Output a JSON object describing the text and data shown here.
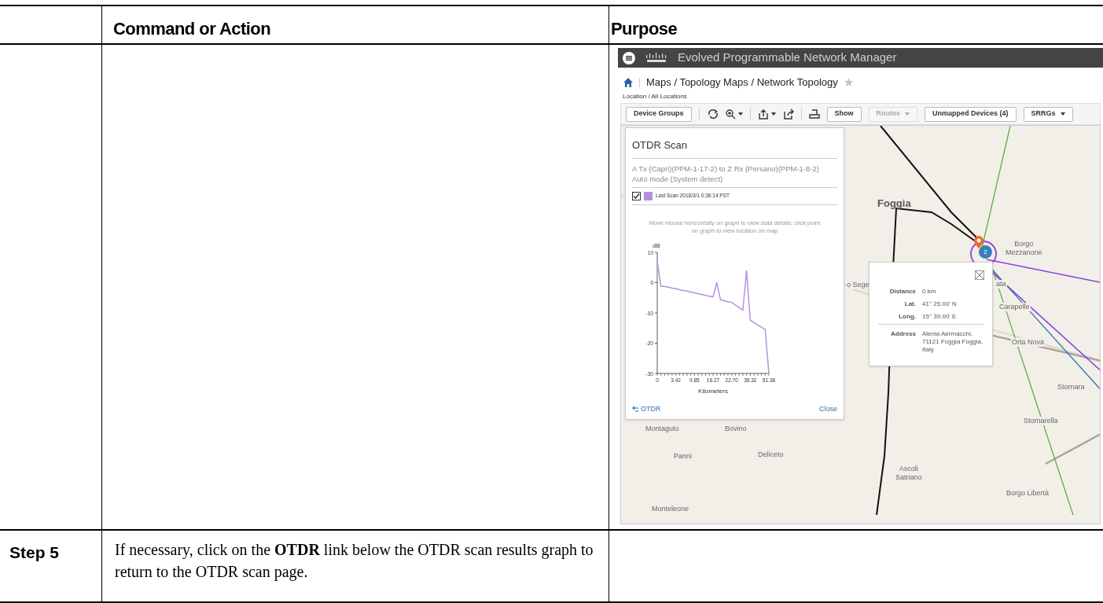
{
  "table": {
    "columns": [
      "Command or Action",
      "Purpose"
    ],
    "rows": [
      {
        "step": null,
        "command": null,
        "screenshot": {
          "app_title": "Evolved Programmable Network Manager",
          "breadcrumb": "Maps / Topology Maps / Network Topology",
          "favorite": false,
          "location": "Location / All Locations",
          "toolbar": [
            {
              "label": "Device Groups",
              "disabled": false,
              "dropdown": false
            },
            {
              "label": "Show",
              "disabled": false,
              "dropdown": false
            },
            {
              "label": "Routes",
              "disabled": true,
              "dropdown": true
            },
            {
              "label": "Unmapped Devices (4)",
              "disabled": false,
              "dropdown": false
            },
            {
              "label": "SRRGs",
              "disabled": false,
              "dropdown": true
            }
          ],
          "otdr_panel": {
            "title": "OTDR Scan",
            "link": "A Tx (Capri)(PPM-1-17-2) to Z Rx (Persano)(PPM-1-8-2)",
            "mode": "Auto mode (System detect)",
            "legend": {
              "checked": true,
              "color": "#b392d9",
              "label": "Last Scan 2018/3/1 0:36:14 PST"
            },
            "hint": "Move mouse horizontally on graph to view data details; click point on graph to view location on map",
            "chart_data": {
              "type": "line",
              "xlabel": "Kilometers",
              "ylabel": "dB",
              "categories": [
                "0",
                null,
                null,
                null,
                null,
                "3.42",
                null,
                null,
                null,
                null,
                "9.85",
                null,
                null,
                null,
                null,
                "16.27",
                null,
                null,
                null,
                null,
                "22.70",
                null,
                null,
                null,
                null,
                "35.32",
                null,
                null,
                null,
                null,
                "51.38"
              ],
              "series": [
                {
                  "color": "#b392d9",
                  "values": [
                    7,
                    -1.2,
                    -1.3,
                    -1.5,
                    -1.8,
                    -2.0,
                    -2.3,
                    -2.6,
                    -2.8,
                    -3.1,
                    -3.4,
                    -3.7,
                    -3.9,
                    -4.2,
                    -4.5,
                    -4.7,
                    0,
                    -5.7,
                    -6.0,
                    -6.3,
                    -6.5,
                    -7.4,
                    -8.2,
                    -9.1,
                    4,
                    -12.4,
                    -13.2,
                    -14.0,
                    -14.7,
                    -15.5,
                    -30
                  ]
                }
              ],
              "ylim": [
                -30,
                10
              ],
              "yticks": [
                10,
                0,
                -10,
                -20,
                -30
              ]
            },
            "back_link": "OTDR",
            "close": "Close"
          },
          "map": {
            "labels": [
              {
                "text": "Foggia",
                "major": true
              },
              {
                "text": "Borgo\nMezzanone",
                "major": false
              },
              {
                "text": "o Sege",
                "major": false
              },
              {
                "text": "ata",
                "major": false
              },
              {
                "text": "Carapelle",
                "major": false
              },
              {
                "text": "Orta Nova",
                "major": false
              },
              {
                "text": "Stornara",
                "major": false
              },
              {
                "text": "Stornarella",
                "major": false
              },
              {
                "text": "Ascoli\nSatriano",
                "major": false
              },
              {
                "text": "Borgo Libertà",
                "major": false
              },
              {
                "text": "Montaguto",
                "major": false
              },
              {
                "text": "Bovino",
                "major": false
              },
              {
                "text": "Panni",
                "major": false
              },
              {
                "text": "Deliceto",
                "major": false
              },
              {
                "text": "Monteleone",
                "major": false
              }
            ],
            "cluster_count": "2",
            "popup": {
              "fields": [
                {
                  "label": "Distance",
                  "value": "0 km"
                },
                {
                  "label": "Lat.",
                  "value": "41° 25.00' N"
                },
                {
                  "label": "Long.",
                  "value": "15° 39.00' E"
                },
                {
                  "label": "Address",
                  "value": "Alenia Aermacchi, 71121 Foggia Foggia, Italy"
                }
              ]
            }
          }
        }
      },
      {
        "step": "Step 5",
        "command": "If necessary, click on the **OTDR** link below the OTDR scan results graph to return to the OTDR scan page.",
        "screenshot": null
      }
    ]
  }
}
